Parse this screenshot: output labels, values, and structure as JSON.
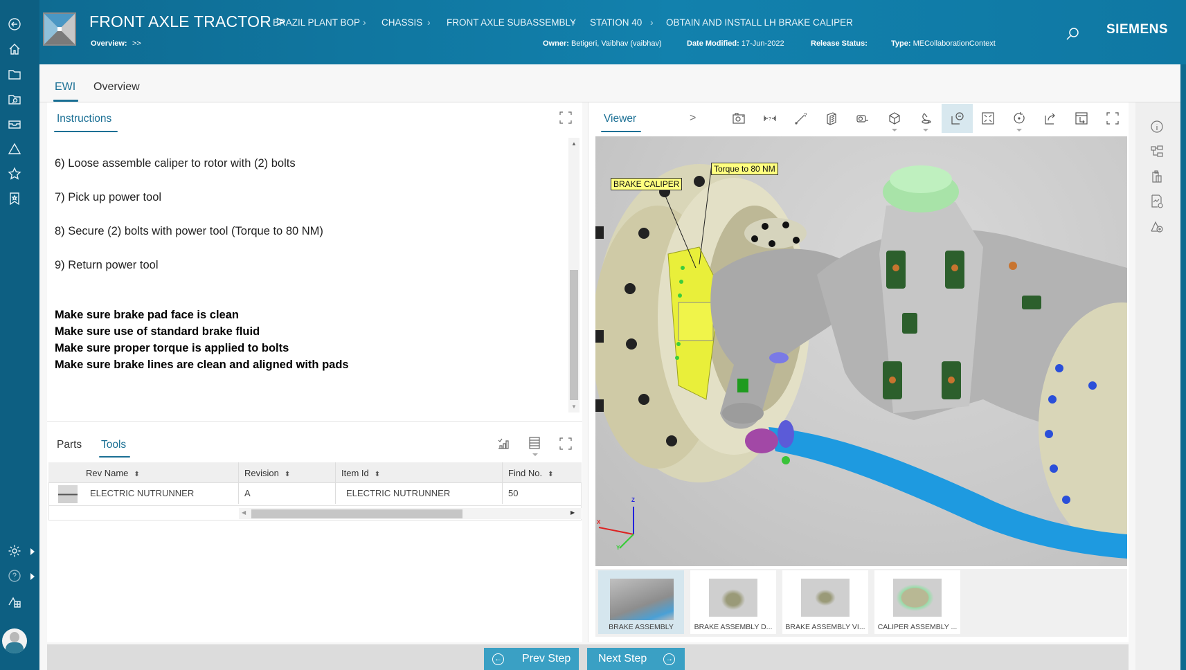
{
  "header": {
    "title": "FRONT AXLE TRACTOR >",
    "breadcrumbs": [
      "BRAZIL PLANT BOP",
      "CHASSIS",
      "FRONT AXLE SUBASSEMBLY",
      "STATION 40",
      "OBTAIN AND INSTALL LH BRAKE CALIPER"
    ],
    "overview_label": "Overview:",
    "overview_value": ">>",
    "owner_label": "Owner:",
    "owner_value": "Betigeri, Vaibhav (vaibhav)",
    "date_label": "Date Modified:",
    "date_value": "17-Jun-2022",
    "release_label": "Release Status:",
    "release_value": "",
    "type_label": "Type:",
    "type_value": "MECollaborationContext",
    "brand": "SIEMENS",
    "search_icon": "search-icon"
  },
  "leftnav": {
    "icons": [
      "back-icon",
      "home-icon",
      "folder-icon",
      "folder-search-icon",
      "inbox-icon",
      "change-triangle-icon",
      "favorites-star-icon",
      "bookmark-icon"
    ],
    "bottom_icons": [
      "settings-gear-icon",
      "help-icon",
      "workspace-icon",
      "user-avatar"
    ]
  },
  "tabs": [
    {
      "label": "EWI",
      "active": true
    },
    {
      "label": "Overview",
      "active": false
    }
  ],
  "instructions": {
    "title": "Instructions",
    "steps": [
      "6) Loose assemble caliper to rotor with (2) bolts",
      "7) Pick up power tool",
      "8) Secure (2) bolts with power tool (Torque to 80 NM)",
      "9) Return power tool"
    ],
    "notes": [
      "Make sure brake pad face is clean",
      "Make sure use of standard brake fluid",
      "Make sure proper torque is applied to bolts",
      "Make sure brake lines are clean and aligned with pads"
    ]
  },
  "parts_tools": {
    "tabs": [
      {
        "label": "Parts",
        "active": false
      },
      {
        "label": "Tools",
        "active": true
      }
    ],
    "columns": [
      "Rev Name",
      "Revision",
      "Item Id",
      "Find No."
    ],
    "rows": [
      {
        "rev_name": "ELECTRIC NUTRUNNER",
        "revision": "A",
        "item_id": "ELECTRIC NUTRUNNER",
        "find_no": "50"
      }
    ]
  },
  "viewer": {
    "title": "Viewer",
    "expand_label": ">",
    "toolbar": [
      "snapshot-icon",
      "measure-distance-icon",
      "measure-line-icon",
      "section-icon",
      "markup-icon",
      "display-style-icon",
      "lighting-icon",
      "pmi-callout-icon",
      "fit-all-icon",
      "rotate-icon",
      "share-icon",
      "view-orientation-icon",
      "fullscreen-icon"
    ],
    "callouts": [
      "BRAKE CALIPER",
      "Torque to 80 NM"
    ],
    "axes": [
      "X",
      "Y",
      "Z"
    ],
    "snapshots": [
      {
        "label": "BRAKE ASSEMBLY",
        "selected": true
      },
      {
        "label": "BRAKE ASSEMBLY D...",
        "selected": false
      },
      {
        "label": "BRAKE ASSEMBLY VI...",
        "selected": false
      },
      {
        "label": "CALIPER ASSEMBLY ...",
        "selected": false
      }
    ]
  },
  "siderail": [
    "info-icon",
    "structure-icon",
    "clipboard-icon",
    "report-icon",
    "add-shape-icon"
  ],
  "footer": {
    "prev_label": "Prev Step",
    "next_label": "Next Step"
  },
  "colors": {
    "header_bg": "#0e6b92",
    "accent": "#1a6f94",
    "button_bg": "#3aa0c4",
    "callout_bg": "#ffff80"
  }
}
